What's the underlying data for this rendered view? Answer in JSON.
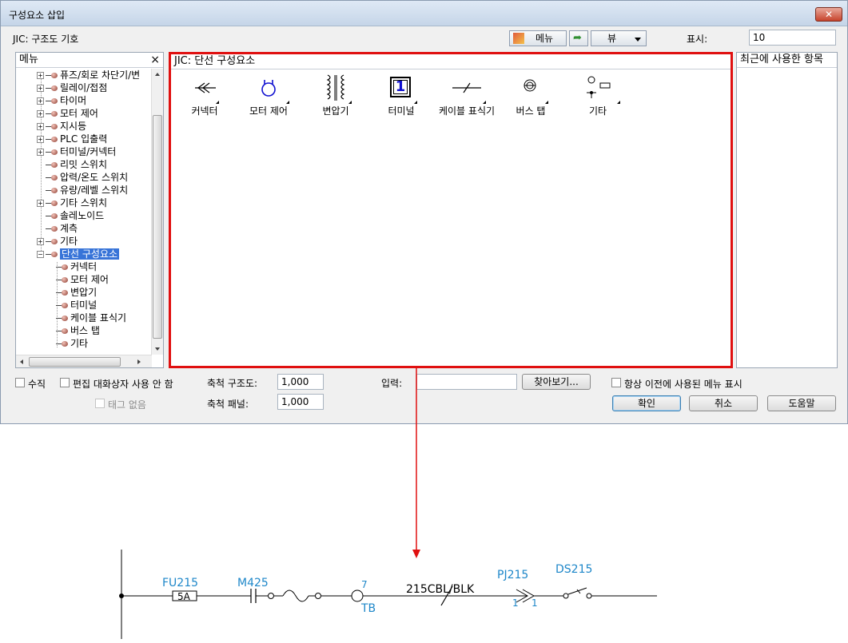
{
  "window": {
    "title": "구성요소 삽입",
    "close": "✕"
  },
  "header": {
    "subtitle": "JIC: 구조도 기호",
    "menu_btn": "메뉴",
    "view_btn": "뷰",
    "display_label": "표시:",
    "display_value": "10"
  },
  "menu_panel": {
    "title": "메뉴",
    "close": "×",
    "items": [
      "퓨즈/회로 차단기/변",
      "릴레이/접점",
      "타이머",
      "모터 제어",
      "지시등",
      "PLC 입출력",
      "터미널/커넥터",
      "리밋 스위치",
      "압력/온도 스위치",
      "유량/레벨 스위치",
      "기타 스위치",
      "솔레노이드",
      "계측",
      "기타",
      "단선 구성요소"
    ],
    "children": [
      "커넥터",
      "모터 제어",
      "변압기",
      "터미널",
      "케이블 표식기",
      "버스 탭",
      "기타"
    ]
  },
  "main_panel": {
    "title": "JIC: 단선 구성요소",
    "symbols": [
      {
        "label": "커넥터",
        "icon": "connector-icon"
      },
      {
        "label": "모터 제어",
        "icon": "motor-control-icon"
      },
      {
        "label": "변압기",
        "icon": "transformer-icon"
      },
      {
        "label": "터미널",
        "icon": "terminal-icon",
        "glyph": "1"
      },
      {
        "label": "케이블 표식기",
        "icon": "cable-marker-icon"
      },
      {
        "label": "버스 탭",
        "icon": "bus-tap-icon"
      },
      {
        "label": "기타",
        "icon": "misc-icon"
      }
    ]
  },
  "recent_panel": {
    "title": "최근에 사용한 항목"
  },
  "options": {
    "vertical": "수직",
    "no_edit_dialog": "편집 대화상자 사용 안 함",
    "no_tag": "태그 없음",
    "scale_schematic_label": "축척 구조도:",
    "scale_schematic_value": "1,000",
    "scale_panel_label": "축척 패널:",
    "scale_panel_value": "1,000",
    "input_label": "입력:",
    "input_value": "",
    "browse": "찾아보기...",
    "always_show_prev": "항상 이전에 사용된 메뉴 표시"
  },
  "buttons": {
    "ok": "확인",
    "cancel": "취소",
    "help": "도움말"
  },
  "schematic": {
    "fuse_tag": "FU215",
    "fuse_rating": "5A",
    "motor_tag": "M425",
    "terminal_number": "7",
    "terminal_tag": "TB",
    "cable_label": "215CBL/BLK",
    "plug_tag": "PJ215",
    "plug_pin_a": "1",
    "plug_pin_b": "1",
    "switch_tag": "DS215"
  },
  "colors": {
    "highlight": "#e01010",
    "schematic_text": "#1e87c9",
    "selection": "#3874d8"
  }
}
